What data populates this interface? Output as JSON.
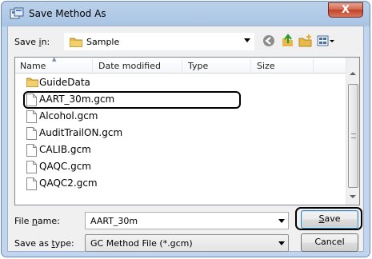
{
  "window": {
    "title": "Save Method As",
    "close_label": "X"
  },
  "save_in": {
    "label_pre": "Save ",
    "label_ul": "i",
    "label_post": "n:",
    "value": "Sample"
  },
  "toolbar": {
    "icons": [
      "back-icon",
      "up-folder-icon",
      "new-folder-icon",
      "view-menu-icon"
    ]
  },
  "columns": {
    "name": "Name",
    "date_modified": "Date modified",
    "type": "Type",
    "size": "Size"
  },
  "files": [
    {
      "name": "GuideData",
      "kind": "folder"
    },
    {
      "name": "AART_30m.gcm",
      "kind": "file",
      "selected": true
    },
    {
      "name": "Alcohol.gcm",
      "kind": "file"
    },
    {
      "name": "AuditTrailON.gcm",
      "kind": "file"
    },
    {
      "name": "CALIB.gcm",
      "kind": "file"
    },
    {
      "name": "QAQC.gcm",
      "kind": "file"
    },
    {
      "name": "QAQC2.gcm",
      "kind": "file"
    }
  ],
  "file_name": {
    "label_pre": "File ",
    "label_ul": "n",
    "label_post": "ame:",
    "value": "AART_30m"
  },
  "save_as_type": {
    "label_pre": "Save as ",
    "label_ul": "t",
    "label_post": "ype:",
    "value": "GC Method File (*.gcm)"
  },
  "buttons": {
    "save_ul": "S",
    "save_rest": "ave",
    "cancel": "Cancel"
  },
  "colors": {
    "title_bar": "#a9c4e4",
    "close_button": "#c1412a",
    "folder": "#e8b84a"
  }
}
